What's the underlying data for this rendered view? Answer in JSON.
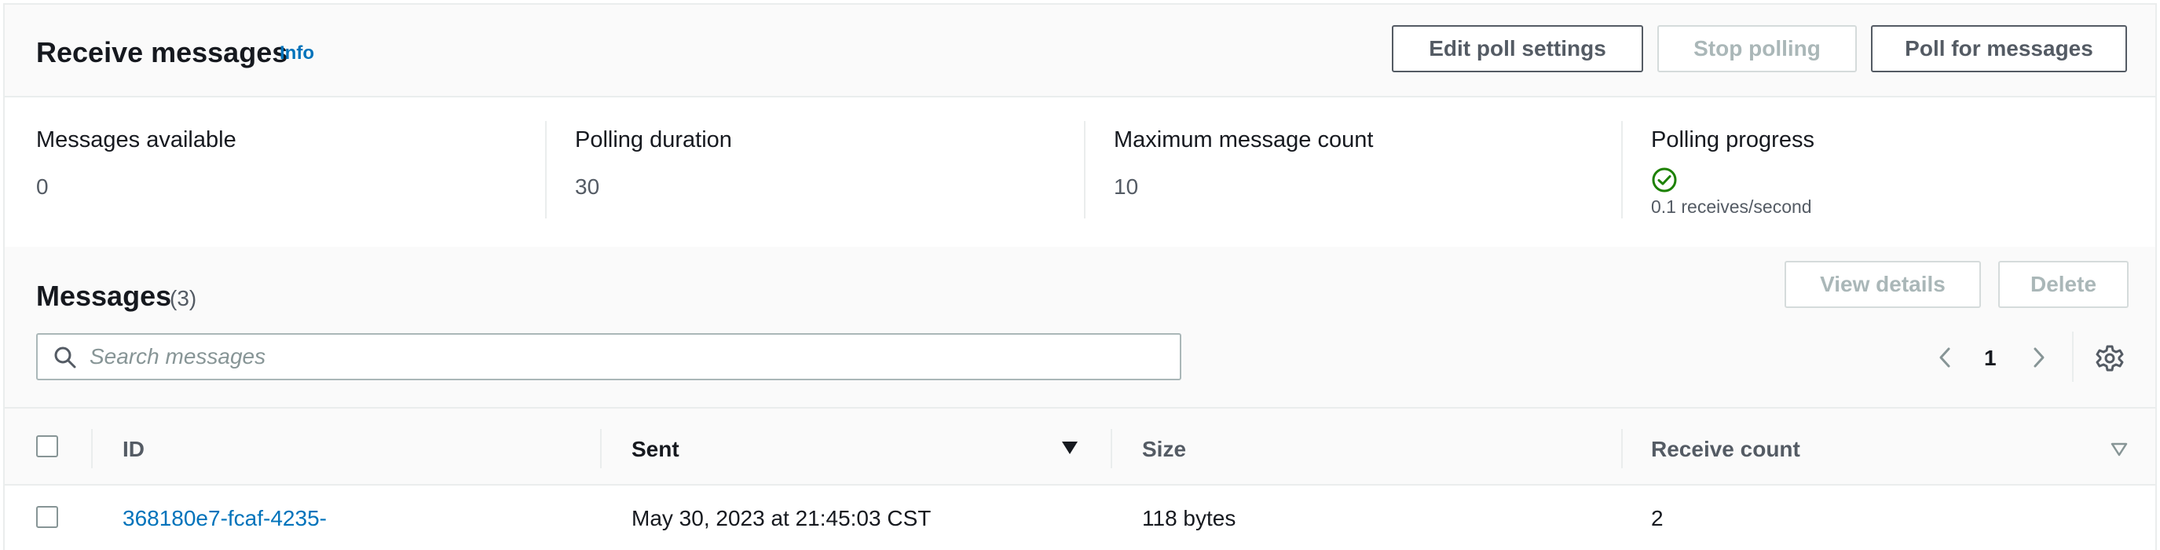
{
  "header": {
    "title": "Receive messages",
    "info_label": "Info",
    "buttons": {
      "edit_poll_settings": "Edit poll settings",
      "stop_polling": "Stop polling",
      "poll_for_messages": "Poll for messages"
    }
  },
  "stats": {
    "messages_available": {
      "label": "Messages available",
      "value": "0"
    },
    "polling_duration": {
      "label": "Polling duration",
      "value": "30"
    },
    "maximum_message_count": {
      "label": "Maximum message count",
      "value": "10"
    },
    "polling_progress": {
      "label": "Polling progress",
      "status_icon": "success-check-icon",
      "rate": "0.1 receives/second"
    }
  },
  "messages": {
    "title": "Messages",
    "count": "(3)",
    "buttons": {
      "view_details": "View details",
      "delete": "Delete"
    },
    "search": {
      "placeholder": "Search messages",
      "value": ""
    },
    "pagination": {
      "current_page": "1"
    },
    "columns": {
      "id": "ID",
      "sent": "Sent",
      "size": "Size",
      "receive_count": "Receive count"
    },
    "rows": [
      {
        "id": "368180e7-fcaf-4235-",
        "sent": "May 30, 2023 at 21:45:03 CST",
        "size": "118 bytes",
        "receive_count": "2"
      }
    ]
  },
  "colors": {
    "link": "#0073bb",
    "success": "#1d8102",
    "text": "#16191f",
    "muted": "#545b64",
    "disabled": "#aab7b8"
  }
}
